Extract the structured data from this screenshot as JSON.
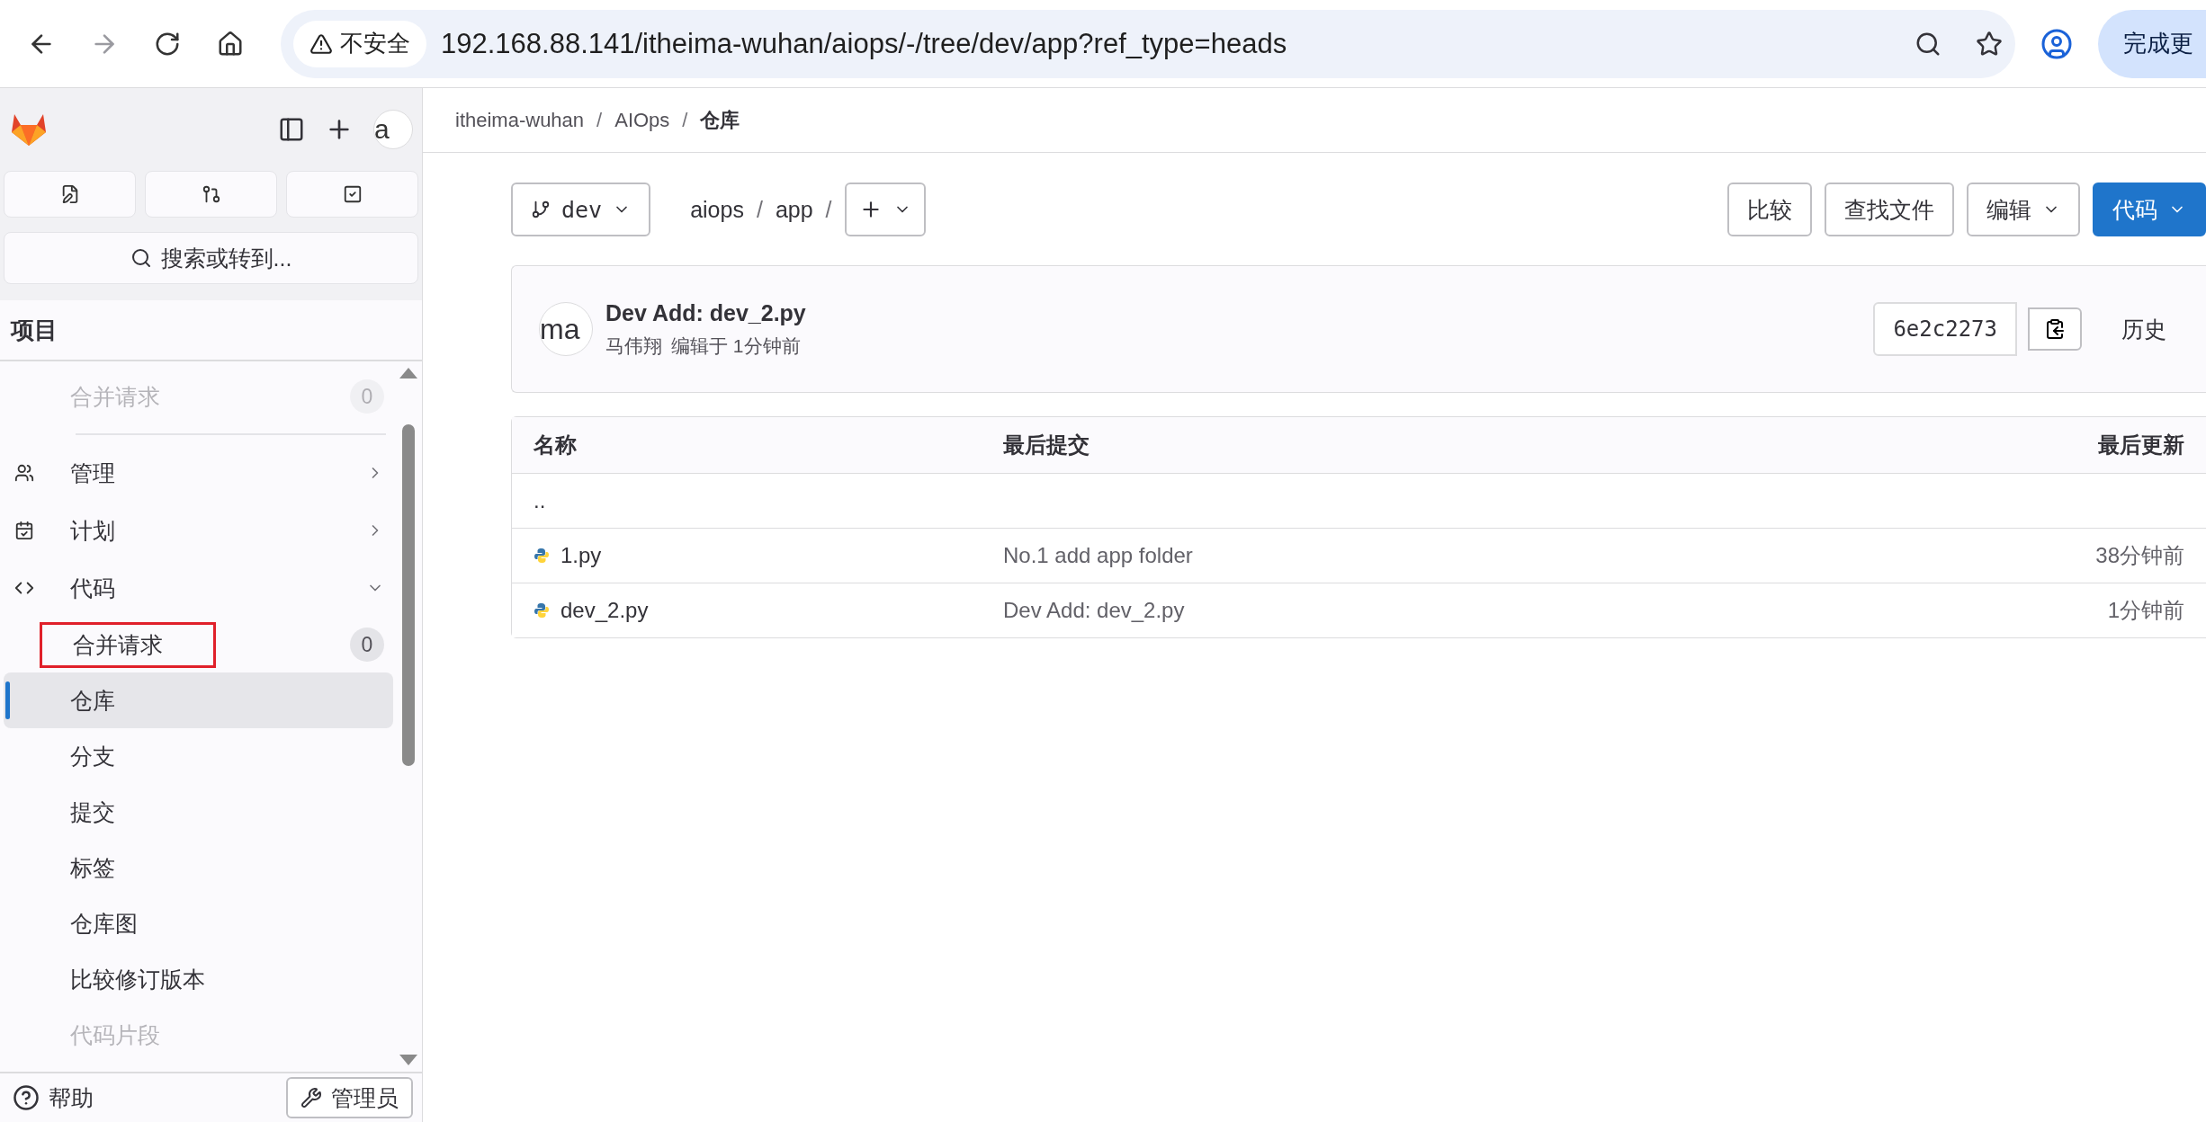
{
  "browser": {
    "security_label": "不安全",
    "url": "192.168.88.141/itheima-wuhan/aiops/-/tree/dev/app?ref_type=heads",
    "update_button": "完成更"
  },
  "sidebar": {
    "avatar_alt": "a",
    "search_placeholder": "搜索或转到...",
    "section_title": "项目",
    "items": [
      {
        "kind": "sub",
        "label": "合并请求",
        "badge": "0",
        "faded": true,
        "selected": false
      },
      {
        "kind": "divider"
      },
      {
        "kind": "group",
        "label": "管理",
        "expanded": false
      },
      {
        "kind": "group",
        "label": "计划",
        "expanded": false
      },
      {
        "kind": "group",
        "label": "代码",
        "expanded": true,
        "children": [
          {
            "label": "合并请求",
            "badge": "0",
            "annotated": true,
            "selected": false,
            "faded": false
          },
          {
            "label": "仓库",
            "selected": true,
            "faded": false
          },
          {
            "label": "分支",
            "selected": false,
            "faded": false
          },
          {
            "label": "提交",
            "selected": false,
            "faded": false
          },
          {
            "label": "标签",
            "selected": false,
            "faded": false
          },
          {
            "label": "仓库图",
            "selected": false,
            "faded": false
          },
          {
            "label": "比较修订版本",
            "selected": false,
            "faded": false
          },
          {
            "label": "代码片段",
            "selected": false,
            "faded": true
          }
        ]
      }
    ],
    "help": "帮助",
    "admin": "管理员"
  },
  "breadcrumb": [
    {
      "kind": "link",
      "text": "itheima-wuhan"
    },
    {
      "kind": "sep",
      "text": "/"
    },
    {
      "kind": "link",
      "text": "AIOps"
    },
    {
      "kind": "sep",
      "text": "/"
    },
    {
      "kind": "current",
      "text": "仓库"
    }
  ],
  "toolbar": {
    "branch": "dev",
    "path": [
      {
        "kind": "link",
        "text": "aiops"
      },
      {
        "kind": "sep",
        "text": "/"
      },
      {
        "kind": "link",
        "text": "app"
      },
      {
        "kind": "sep",
        "text": "/"
      }
    ],
    "buttons": [
      {
        "kind": "plain",
        "label": "比较"
      },
      {
        "kind": "plain",
        "label": "查找文件"
      },
      {
        "kind": "dropdown",
        "label": "编辑"
      },
      {
        "kind": "primary",
        "label": "代码"
      }
    ]
  },
  "commit": {
    "avatar_alt": "ma",
    "title": "Dev Add: dev_2.py",
    "author": "马伟翔",
    "meta": "编辑于 1分钟前",
    "sha": "6e2c2273",
    "history": "历史"
  },
  "table": {
    "columns": [
      "名称",
      "最后提交",
      "最后更新"
    ],
    "rows": [
      {
        "kind": "parent",
        "name": ".."
      },
      {
        "kind": "file",
        "name": "1.py",
        "commit": "No.1 add app folder",
        "updated": "38分钟前"
      },
      {
        "kind": "file",
        "name": "dev_2.py",
        "commit": "Dev Add: dev_2.py",
        "updated": "1分钟前"
      }
    ]
  }
}
